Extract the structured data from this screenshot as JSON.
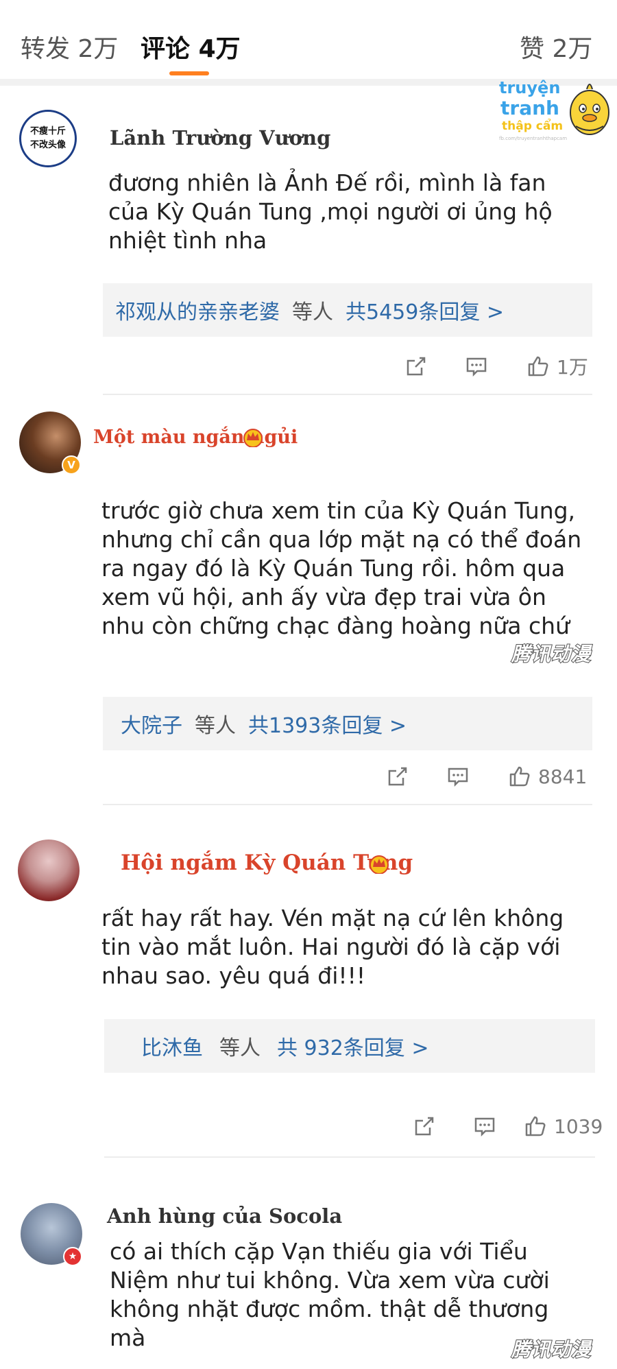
{
  "tabs": [
    {
      "label": "转发",
      "count": "2万"
    },
    {
      "label": "评论",
      "count": "4万"
    },
    {
      "label": "赞",
      "count": "2万"
    }
  ],
  "watermark": {
    "line1": "truyện",
    "line2": "tranh",
    "line3": "thập cẩm",
    "sub": "fb.com/truyentranhthapcam"
  },
  "comments": [
    {
      "username": "Lãnh Trường Vương",
      "avatar_text": [
        "不瘦十斤",
        "不改头像"
      ],
      "text": "đương nhiên là Ảnh Đế rồi,  mình là fan\ncủa Kỳ Quán Tung ,mọi người ơi ủng hộ\nnhiệt tình nha",
      "reply_user": "祁观从的亲亲老婆",
      "reply_mid": "等人",
      "reply_count": "共5459条回复 >",
      "likes": "1万"
    },
    {
      "username": "Một màu ngắn ngủi",
      "text": "trước giờ chưa xem tin của Kỳ Quán Tung,\nnhưng chỉ cần qua lớp mặt nạ có thể đoán\nra ngay đó là Kỳ Quán Tung rồi. hôm qua\nxem vũ hội, anh ấy vừa đẹp trai vừa ôn\nnhu còn  chững chạc đàng hoàng nữa chứ",
      "reply_user": "大院子",
      "reply_mid": "等人",
      "reply_count": "共1393条回复 >",
      "likes": "8841",
      "tencent": "腾讯动漫"
    },
    {
      "username": "Hội ngắm Kỳ Quán Tung",
      "text": "rất hay rất hay. Vén mặt nạ cứ lên không\ntin vào mắt luôn. Hai người đó là cặp với\nnhau sao. yêu quá đi!!!",
      "reply_user": "比沐鱼",
      "reply_mid": "等人",
      "reply_count": "共  932条回复 >",
      "likes": "1039"
    },
    {
      "username": "Anh hùng của Socola",
      "text": "có ai thích cặp Vạn thiếu gia với Tiểu\nNiệm như tui không. Vừa xem vừa cười\nkhông nhặt được mồm. thật dễ thương\nmà",
      "tencent": "腾讯动漫"
    }
  ],
  "colors": {
    "accent": "#ff7f1f",
    "link": "#2f6aa8",
    "username_red": "#d9442b",
    "username_dark": "#333333",
    "reply_bg": "#f3f3f3"
  }
}
